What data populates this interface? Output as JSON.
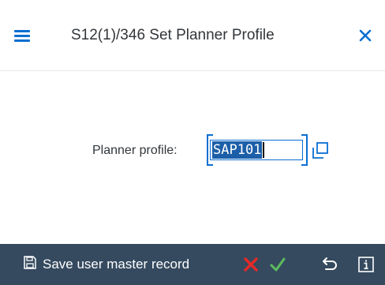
{
  "window": {
    "title": "S12(1)/346 Set Planner Profile"
  },
  "form": {
    "planner_profile_label": "Planner profile:",
    "planner_profile_value": "SAP101"
  },
  "footer": {
    "save_label": "Save user master record"
  },
  "icons": {
    "menu": "menu-icon",
    "close": "close-icon",
    "value_help": "value-help-icon",
    "save": "save-icon",
    "cancel": "cancel-icon",
    "ok": "checkmark-icon",
    "undo": "undo-icon",
    "info": "info-icon"
  },
  "colors": {
    "accent": "#0a6ed1",
    "footer_bg": "#354a5f",
    "cancel_red": "#e52929",
    "ok_green": "#5dbc5d",
    "selection_bg": "#1c5fa8"
  }
}
